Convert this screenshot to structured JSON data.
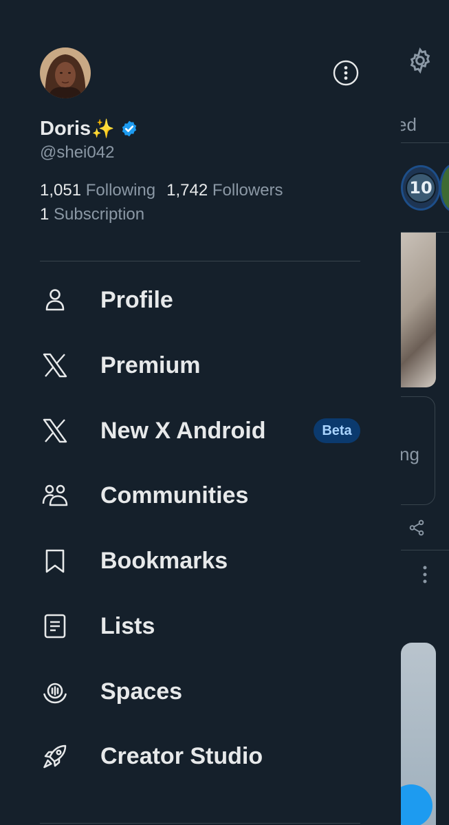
{
  "background": {
    "tab_fragment": "ed",
    "space_badge_number": "10",
    "card_fragment": "ng"
  },
  "profile": {
    "display_name": "Doris",
    "name_emoji": "✨",
    "verified": true,
    "handle": "@shei042",
    "following_count": "1,051",
    "following_label": "Following",
    "followers_count": "1,742",
    "followers_label": "Followers",
    "subscriptions_count": "1",
    "subscriptions_label": "Subscription"
  },
  "menu": {
    "items": [
      {
        "label": "Profile",
        "icon": "person-icon"
      },
      {
        "label": "Premium",
        "icon": "x-logo-icon"
      },
      {
        "label": "New X Android",
        "icon": "x-logo-icon",
        "badge": "Beta"
      },
      {
        "label": "Communities",
        "icon": "communities-icon"
      },
      {
        "label": "Bookmarks",
        "icon": "bookmark-icon"
      },
      {
        "label": "Lists",
        "icon": "list-icon"
      },
      {
        "label": "Spaces",
        "icon": "spaces-icon"
      },
      {
        "label": "Creator Studio",
        "icon": "rocket-icon"
      }
    ]
  },
  "colors": {
    "background": "#15202b",
    "divider": "#38444d",
    "secondary_text": "#8b98a5",
    "primary_text": "#e7e9ea",
    "accent": "#1d9bf0",
    "beta_bg": "#0b3a6e"
  }
}
